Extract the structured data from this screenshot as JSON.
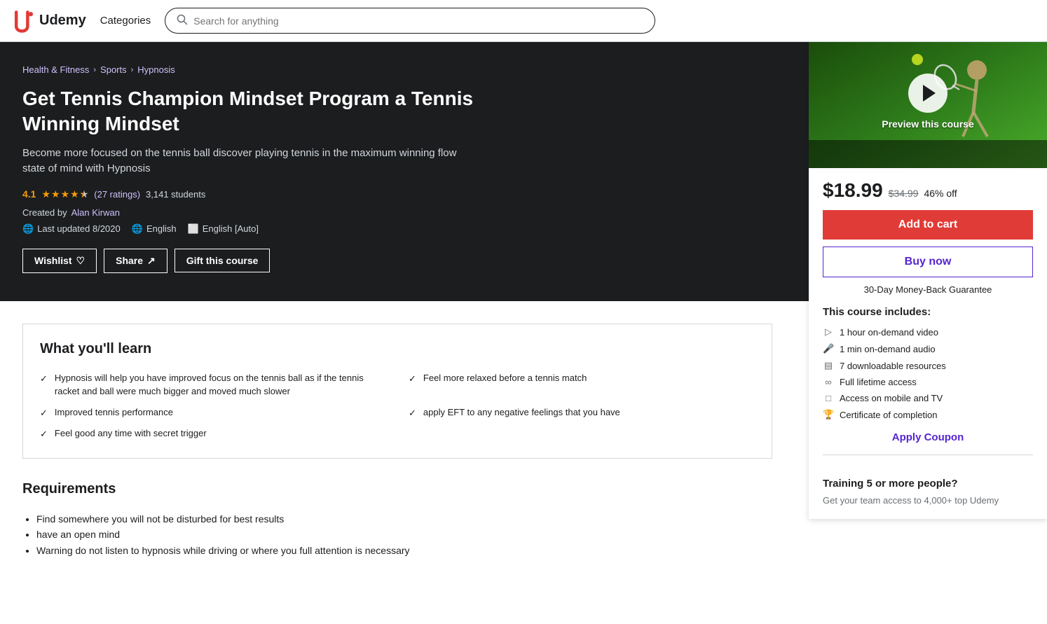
{
  "header": {
    "logo_text": "Udemy",
    "categories_label": "Categories",
    "search_placeholder": "Search for anything"
  },
  "breadcrumb": {
    "items": [
      {
        "label": "Health & Fitness",
        "href": "#"
      },
      {
        "label": "Sports",
        "href": "#"
      },
      {
        "label": "Hypnosis",
        "href": "#"
      }
    ]
  },
  "course": {
    "title": "Get Tennis Champion Mindset Program a Tennis Winning Mindset",
    "subtitle": "Become more focused on the tennis ball discover playing tennis in the maximum winning flow state of mind with Hypnosis",
    "rating_num": "4.1",
    "rating_count": "(27 ratings)",
    "students": "3,141 students",
    "instructor_label": "Created by",
    "instructor_name": "Alan Kirwan",
    "last_updated_label": "Last updated",
    "last_updated": "8/2020",
    "language": "English",
    "caption": "English [Auto]",
    "wishlist_label": "Wishlist",
    "share_label": "Share",
    "gift_label": "Gift this course"
  },
  "sidebar": {
    "preview_label": "Preview this course",
    "price_current": "$18.99",
    "price_original": "$34.99",
    "price_discount": "46% off",
    "add_to_cart_label": "Add to cart",
    "buy_now_label": "Buy now",
    "guarantee_label": "30-Day Money-Back Guarantee",
    "includes_title": "This course includes:",
    "includes_items": [
      {
        "icon": "video",
        "text": "1 hour on-demand video"
      },
      {
        "icon": "audio",
        "text": "1 min on-demand audio"
      },
      {
        "icon": "download",
        "text": "7 downloadable resources"
      },
      {
        "icon": "infinity",
        "text": "Full lifetime access"
      },
      {
        "icon": "mobile",
        "text": "Access on mobile and TV"
      },
      {
        "icon": "certificate",
        "text": "Certificate of completion"
      }
    ],
    "apply_coupon_label": "Apply Coupon",
    "team_title": "Training 5 or more people?",
    "team_text": "Get your team access to 4,000+ top Udemy"
  },
  "learn_section": {
    "title": "What you'll learn",
    "items": [
      "Hypnosis will help you have improved focus on the tennis ball as if the tennis racket and ball were much bigger and moved much slower",
      "Feel more relaxed before a tennis match",
      "Improved tennis performance",
      "apply EFT to any negative feelings that you have",
      "Feel good any time with secret trigger"
    ]
  },
  "requirements_section": {
    "title": "Requirements",
    "items": [
      "Find somewhere you will not be disturbed for best results",
      "have an open mind",
      "Warning do not listen to hypnosis while driving or where you full attention is necessary"
    ]
  }
}
